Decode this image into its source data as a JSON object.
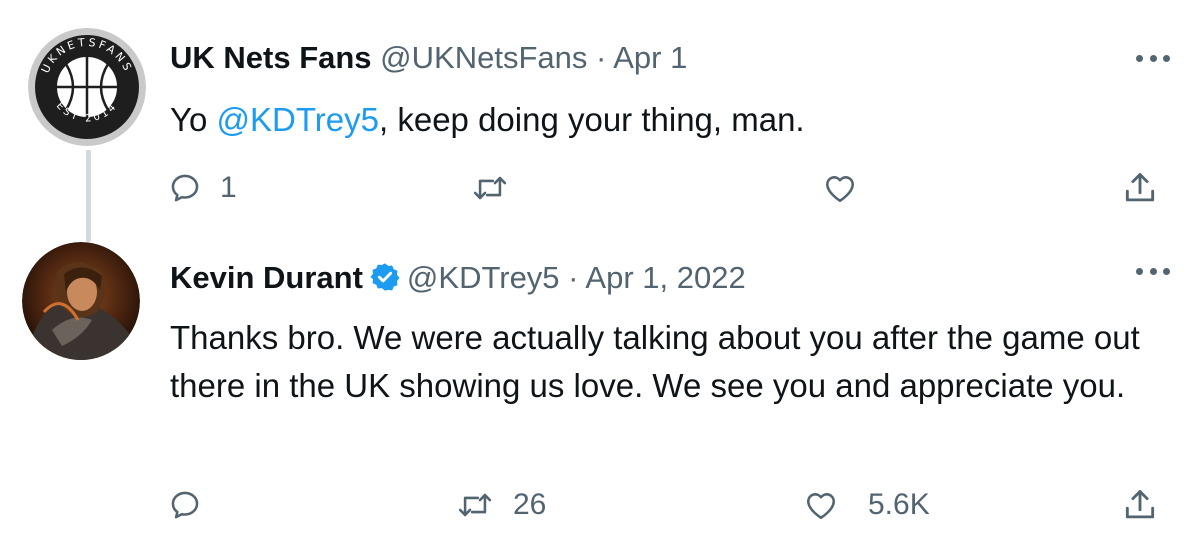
{
  "tweets": [
    {
      "name": "UK Nets Fans",
      "handle": "@UKNetsFans",
      "separator": "·",
      "date": "Apr 1",
      "text_prefix": "Yo ",
      "mention": "@KDTrey5",
      "text_suffix": ", keep doing your thing, man.",
      "avatar_text_top": "UKNETSFANS",
      "avatar_text_bottom": "EST 2014",
      "replies": "1",
      "retweets": "",
      "likes": "",
      "avatar_icon": "basketball-logo"
    },
    {
      "name": "Kevin Durant",
      "verified": true,
      "handle": "@KDTrey5",
      "separator": "·",
      "date": "Apr 1, 2022",
      "text": "Thanks bro. We were actually talking about you after the game out there in the UK showing us love. We see you and appreciate you.",
      "replies": "",
      "retweets": "26",
      "likes": "5.6K",
      "avatar_icon": "animated-character-photo"
    }
  ],
  "colors": {
    "text": "#0f1419",
    "secondary": "#536471",
    "link": "#1d9bf0",
    "verified": "#1d9bf0",
    "thread_line": "#cfd9de"
  },
  "icons": [
    "reply-icon",
    "retweet-icon",
    "like-icon",
    "share-icon",
    "more-icon",
    "verified-badge-icon"
  ]
}
